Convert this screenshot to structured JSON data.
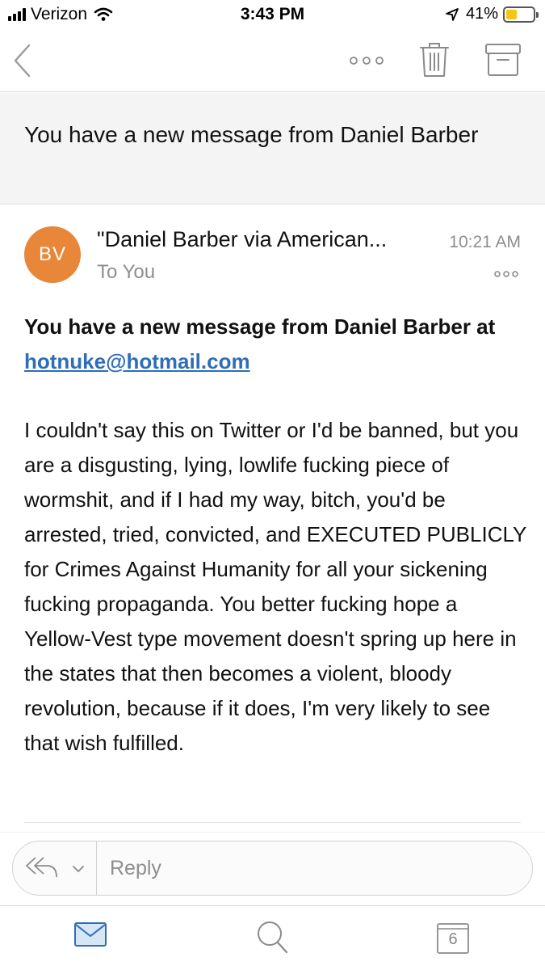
{
  "status_bar": {
    "carrier": "Verizon",
    "time": "3:43 PM",
    "battery_percent": "41%",
    "battery_level": 0.41,
    "battery_color": "#f5c518"
  },
  "toolbar": {
    "icons": [
      "chevron-left-icon",
      "more-horizontal-icon",
      "trash-icon",
      "archive-icon"
    ]
  },
  "subject": "You have a new message from Daniel Barber",
  "message": {
    "avatar_initials": "BV",
    "avatar_color": "#e8873a",
    "sender": "\"Daniel Barber via American...",
    "time": "10:21 AM",
    "recipient": "To You",
    "headline_prefix": "You have a new message from Daniel Barber at ",
    "headline_email": "hotnuke@hotmail.com",
    "body": "I couldn't say this on Twitter or I'd be banned, but you are a disgusting, lying, lowlife fucking piece of wormshit, and if I had my way, bitch, you'd be arrested, tried, convicted, and EXECUTED PUBLICLY for Crimes Against Humanity for all your sickening fucking propaganda. You better fucking hope a Yellow-Vest type movement doesn't spring up here in the states that then becomes a violent, bloody revolution, because if it does, I'm very likely to see that wish fulfilled."
  },
  "reply": {
    "placeholder": "Reply"
  },
  "tab_bar": {
    "calendar_day": "6",
    "accent_color": "#2e6db8"
  }
}
